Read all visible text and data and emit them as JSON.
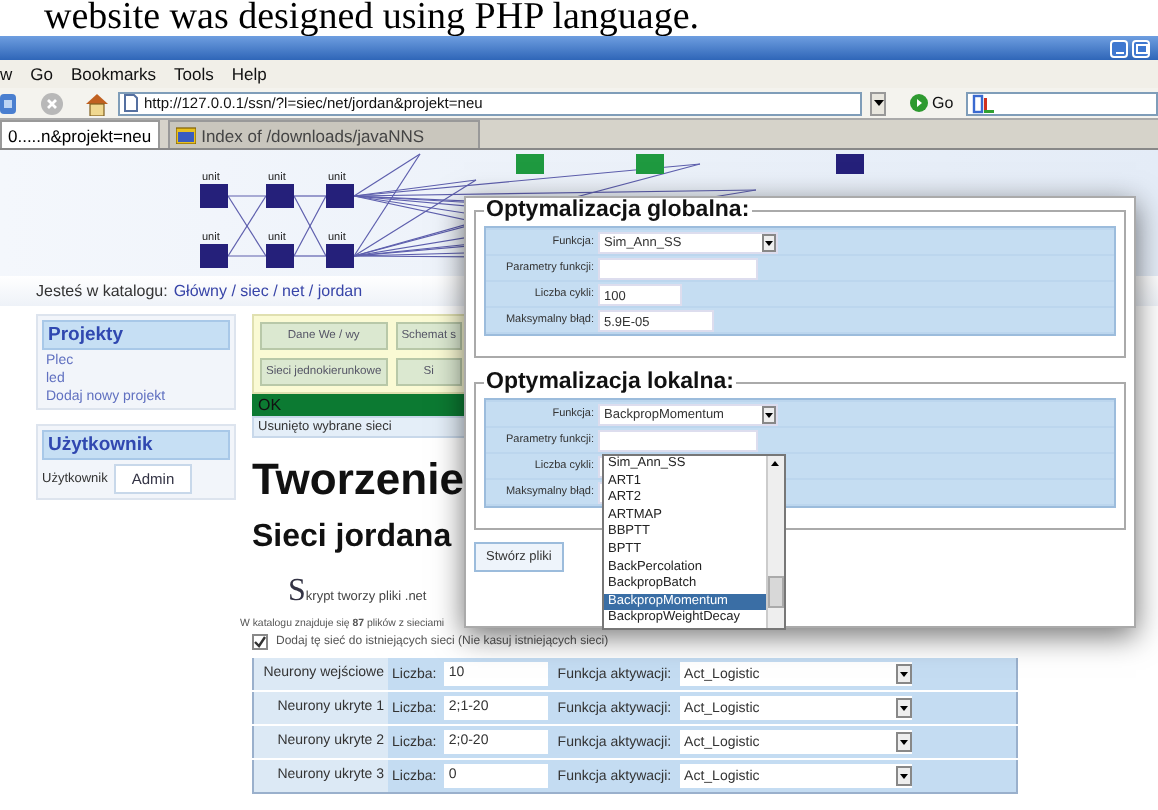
{
  "document_text": "website was designed using PHP language.",
  "menu": [
    "w",
    "Go",
    "Bookmarks",
    "Tools",
    "Help"
  ],
  "address_bar": {
    "value": "http://127.0.0.1/ssn/?l=siec/net/jordan&projekt=neu"
  },
  "go_button": "Go",
  "tabs": [
    {
      "label": "0.....n&projekt=neu",
      "selected": true
    },
    {
      "label": "Index of /downloads/javaNNS",
      "selected": false
    }
  ],
  "banner": {
    "node_labels": [
      "unit",
      "unit",
      "unit",
      "unit",
      "unit",
      "unit"
    ]
  },
  "breadcrumb": {
    "label": "Jesteś w katalogu:",
    "path": "Główny / siec / net / jordan"
  },
  "sidebar": {
    "projects": {
      "title": "Projekty",
      "items": [
        "Plec",
        "led",
        "Dodaj nowy projekt"
      ]
    },
    "user": {
      "title": "Użytkownik",
      "label": "Użytkownik",
      "value": "Admin"
    }
  },
  "nav_buttons": [
    {
      "label": "Dane We / wy"
    },
    {
      "label": "Schemat s"
    },
    {
      "label": "Sieci jednokierunkowe"
    },
    {
      "label": "Si"
    }
  ],
  "status": {
    "kind": "success",
    "text": "OK"
  },
  "message": "Usunięto wybrane sieci",
  "heading": "Tworzenie",
  "subheading": "Sieci jordana",
  "intro": "Skrypt tworzy pliki .net",
  "count_text": "W katalogu znajduje się **87** plików z sieciami",
  "option": {
    "label": "Dodaj tę sieć do istniejących sieci (Nie kasuj istniejących sieci)",
    "checked": true
  },
  "layers": [
    {
      "name": "Neurony wejściowe",
      "count_label": "Liczba:",
      "count": "10",
      "function_label": "Funkcja aktywacji:",
      "function": "Act_Logistic"
    },
    {
      "name": "Neurony ukryte 1",
      "count_label": "Liczba:",
      "count": "2;1-20",
      "function_label": "Funkcja aktywacji:",
      "function": "Act_Logistic"
    },
    {
      "name": "Neurony ukryte 2",
      "count_label": "Liczba:",
      "count": "2;0-20",
      "function_label": "Funkcja aktywacji:",
      "function": "Act_Logistic"
    },
    {
      "name": "Neurony ukryte 3",
      "count_label": "Liczba:",
      "count": "0",
      "function_label": "Funkcja aktywacji:",
      "function": "Act_Logistic"
    }
  ],
  "dialog": {
    "sections": [
      {
        "title": "Optymalizacja globalna:",
        "fields": [
          {
            "label": "Funkcja:",
            "kind": "select",
            "value": "Sim_Ann_SS"
          },
          {
            "label": "Parametry funkcji:",
            "kind": "text"
          },
          {
            "label": "Liczba cykli:",
            "kind": "text",
            "value": "100"
          },
          {
            "label": "Maksymalny błąd:",
            "kind": "text",
            "value": "5.9E-05"
          }
        ]
      },
      {
        "title": "Optymalizacja lokalna:",
        "fields": [
          {
            "label": "Funkcja:",
            "kind": "select",
            "value": "BackpropMomentum"
          },
          {
            "label": "Parametry funkcji:",
            "kind": "text"
          },
          {
            "label": "Liczba cykli:",
            "kind": "text"
          },
          {
            "label": "Maksymalny błąd:",
            "kind": "text"
          }
        ]
      }
    ],
    "button": "Stwórz pliki",
    "dropdown": {
      "options": [
        {
          "label": "Sim_Ann_SS",
          "selected": false
        },
        {
          "label": "ART1",
          "selected": false
        },
        {
          "label": "ART2",
          "selected": false
        },
        {
          "label": "ARTMAP",
          "selected": false
        },
        {
          "label": "BBPTT",
          "selected": false
        },
        {
          "label": "BPTT",
          "selected": false
        },
        {
          "label": "BackPercolation",
          "selected": false
        },
        {
          "label": "BackpropBatch",
          "selected": false
        },
        {
          "label": "BackpropMomentum",
          "selected": true
        },
        {
          "label": "BackpropWeightDecay",
          "selected": false
        }
      ]
    }
  }
}
